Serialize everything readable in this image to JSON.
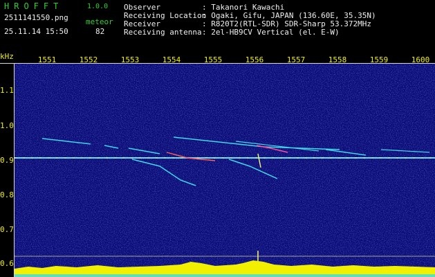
{
  "header": {
    "brand": "HROFFT",
    "version": "1.0.0",
    "filename": "2511141550.png",
    "datetime": "25.11.14 15:50",
    "meteor_label": "meteor",
    "meteor_count": "82",
    "fields": [
      {
        "label": "Observer",
        "value": ": Takanori Kawachi"
      },
      {
        "label": "Receiving Location",
        "value": ": Ogaki, Gifu, JAPAN (136.60E, 35.35N)"
      },
      {
        "label": "Receiver",
        "value": ": R820T2(RTL-SDR) SDR-Sharp 53.372MHz"
      },
      {
        "label": "Receiving antenna",
        "value": ": 2el-HB9CV Vertical (el. E-W)"
      }
    ]
  },
  "axes": {
    "y_unit": "kHz",
    "x_ticks": [
      "1551",
      "1552",
      "1553",
      "1554",
      "1555",
      "1556",
      "1557",
      "1558",
      "1559",
      "1600"
    ],
    "y_ticks": [
      "1.1",
      "1.0",
      "0.9",
      "0.8",
      "0.7",
      "0.6"
    ]
  },
  "colors": {
    "background": "#0b0b74",
    "header_green": "#2fd02f",
    "tick_yellow": "#f0f000",
    "signal_cyan": "#3fd8e8"
  }
}
